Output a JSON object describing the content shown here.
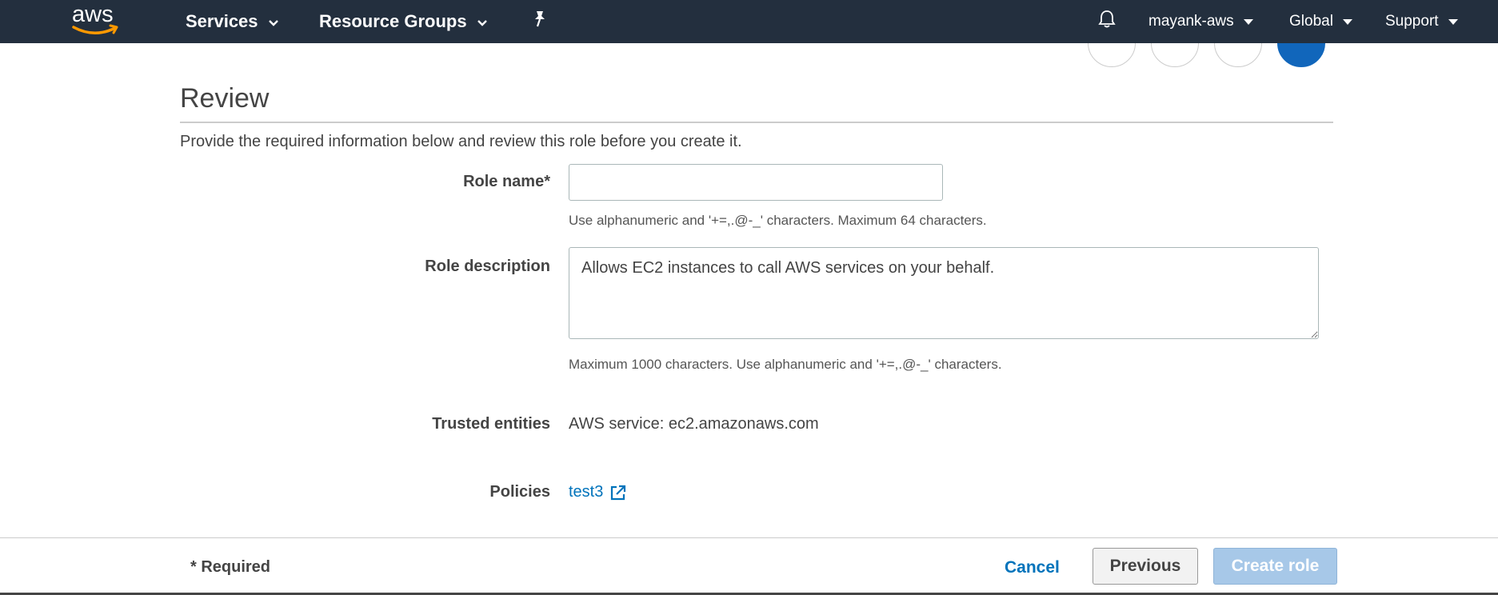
{
  "topnav": {
    "logo_text": "aws",
    "services_label": "Services",
    "resource_groups_label": "Resource Groups",
    "account_label": "mayank-aws",
    "region_label": "Global",
    "support_label": "Support"
  },
  "page": {
    "title": "Review",
    "intro": "Provide the required information below and review this role before you create it."
  },
  "form": {
    "role_name_label": "Role name*",
    "role_name_value": "",
    "role_name_hint": "Use alphanumeric and '+=,.@-_' characters. Maximum 64 characters.",
    "role_description_label": "Role description",
    "role_description_value": "Allows EC2 instances to call AWS services on your behalf.",
    "role_description_hint": "Maximum 1000 characters. Use alphanumeric and '+=,.@-_' characters.",
    "trusted_entities_label": "Trusted entities",
    "trusted_entities_value": "AWS service: ec2.amazonaws.com",
    "policies_label": "Policies",
    "policy_link": "test3"
  },
  "footer": {
    "required_note": "* Required",
    "cancel_label": "Cancel",
    "previous_label": "Previous",
    "create_label": "Create role"
  },
  "colors": {
    "nav_bg": "#232f3e",
    "link": "#0073bb",
    "logo_smile": "#ff9900",
    "active_step": "#1166bb",
    "disabled_primary": "#a7c8e8"
  }
}
